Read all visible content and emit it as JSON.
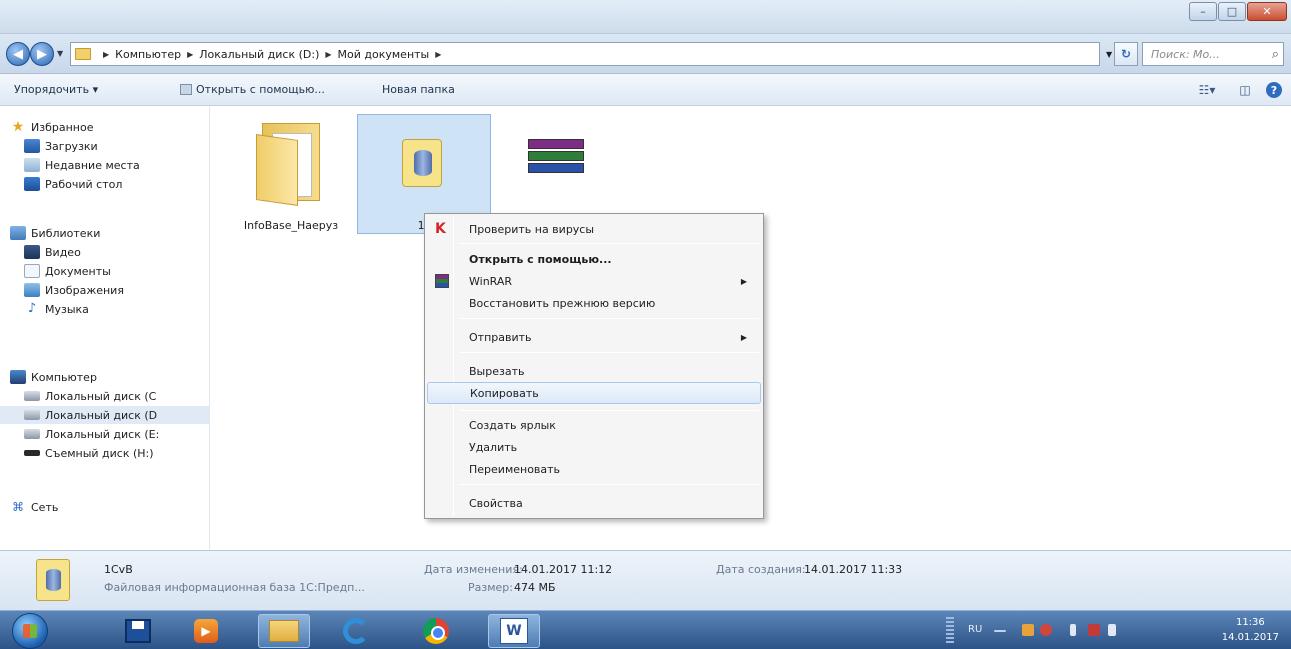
{
  "window": {
    "controls": {
      "minimize": "–",
      "maximize": "□",
      "close": "✕"
    }
  },
  "address_bar": {
    "crumbs": [
      "Компьютер",
      "Локальный диск (D:)",
      "Мой документы"
    ],
    "search_placeholder": "Поиск: Мо..."
  },
  "toolbar": {
    "organize": "Упорядочить ▾",
    "open_with": "Открыть с помощью...",
    "new_folder": "Новая папка"
  },
  "sidebar": {
    "favorites": "Избранное",
    "downloads": "Загрузки",
    "recent": "Недавние места",
    "desktop": "Рабочий стол",
    "libraries": "Библиотеки",
    "video": "Видео",
    "documents": "Документы",
    "images": "Изображения",
    "music": "Музыка",
    "computer": "Компьютер",
    "disk_c": "Локальный диск (C",
    "disk_d": "Локальный диск (D",
    "disk_e": "Локальный диск (E:",
    "removable": "Съемный диск (H:)",
    "network": "Сеть"
  },
  "files": [
    {
      "label": "InfoBase_Наеруз",
      "icon": "folder-icon"
    },
    {
      "label": "1С",
      "icon": "database-icon"
    },
    {
      "label": "",
      "icon": "winrar-archive-icon"
    }
  ],
  "context_menu": {
    "scan": "Проверить на вирусы",
    "open_with": "Открыть с помощью...",
    "winrar": "WinRAR",
    "restore": "Восстановить прежнюю версию",
    "send_to": "Отправить",
    "cut": "Вырезать",
    "copy": "Копировать",
    "shortcut": "Создать ярлык",
    "delete": "Удалить",
    "rename": "Переименовать",
    "properties": "Свойства"
  },
  "details": {
    "name": "1CvB",
    "type": "Файловая информационная база 1С:Предп...",
    "modified_key": "Дата изменения:",
    "modified_val": "14.01.2017 11:12",
    "size_key": "Размер:",
    "size_val": "474 МБ",
    "created_key": "Дата создания:",
    "created_val": "14.01.2017 11:33"
  },
  "taskbar": {
    "language": "RU",
    "time": "11:36",
    "date": "14.01.2017"
  }
}
